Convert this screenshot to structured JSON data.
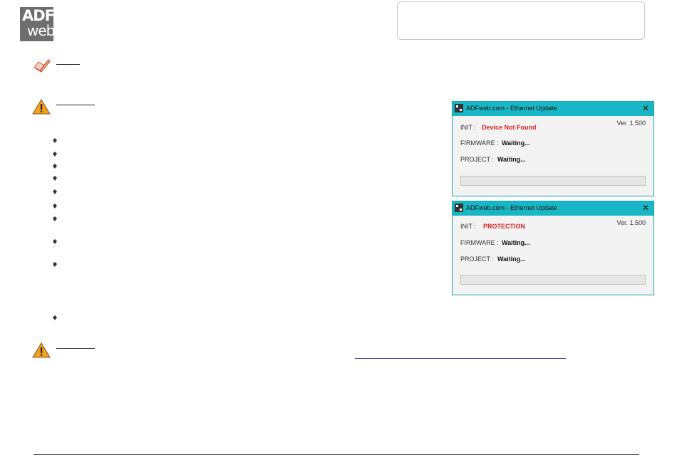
{
  "logo": {
    "line1": "ADF",
    "line2": "web"
  },
  "dialog_protection": {
    "title": "ADFweb.com - Ethernet Update",
    "version": "Ver. 1.500",
    "init_label": "INIT :",
    "init_value": "PROTECTION",
    "firmware_label": "FIRMWARE :",
    "firmware_value": "Waiting...",
    "project_label": "PROJECT :",
    "project_value": "Waiting...",
    "progress": 0
  },
  "dialog_not_found": {
    "title": "ADFweb.com - Ethernet Update",
    "version": "Ver. 1.500",
    "init_label": "INIT :",
    "init_value": "Device Not Found",
    "firmware_label": "FIRMWARE :",
    "firmware_value": "Waiting...",
    "project_label": "PROJECT :",
    "project_value": "Waiting...",
    "progress": 0
  },
  "colors": {
    "titlebar": "#19b7c6",
    "error_text": "#e0201b",
    "warning_icon": "#f0a020"
  },
  "icons": {
    "note": "pencil-note-icon",
    "warning": "warning-triangle-icon",
    "bullet": "diamond-bullet-icon",
    "close": "close-icon",
    "app": "adfweb-app-icon"
  }
}
